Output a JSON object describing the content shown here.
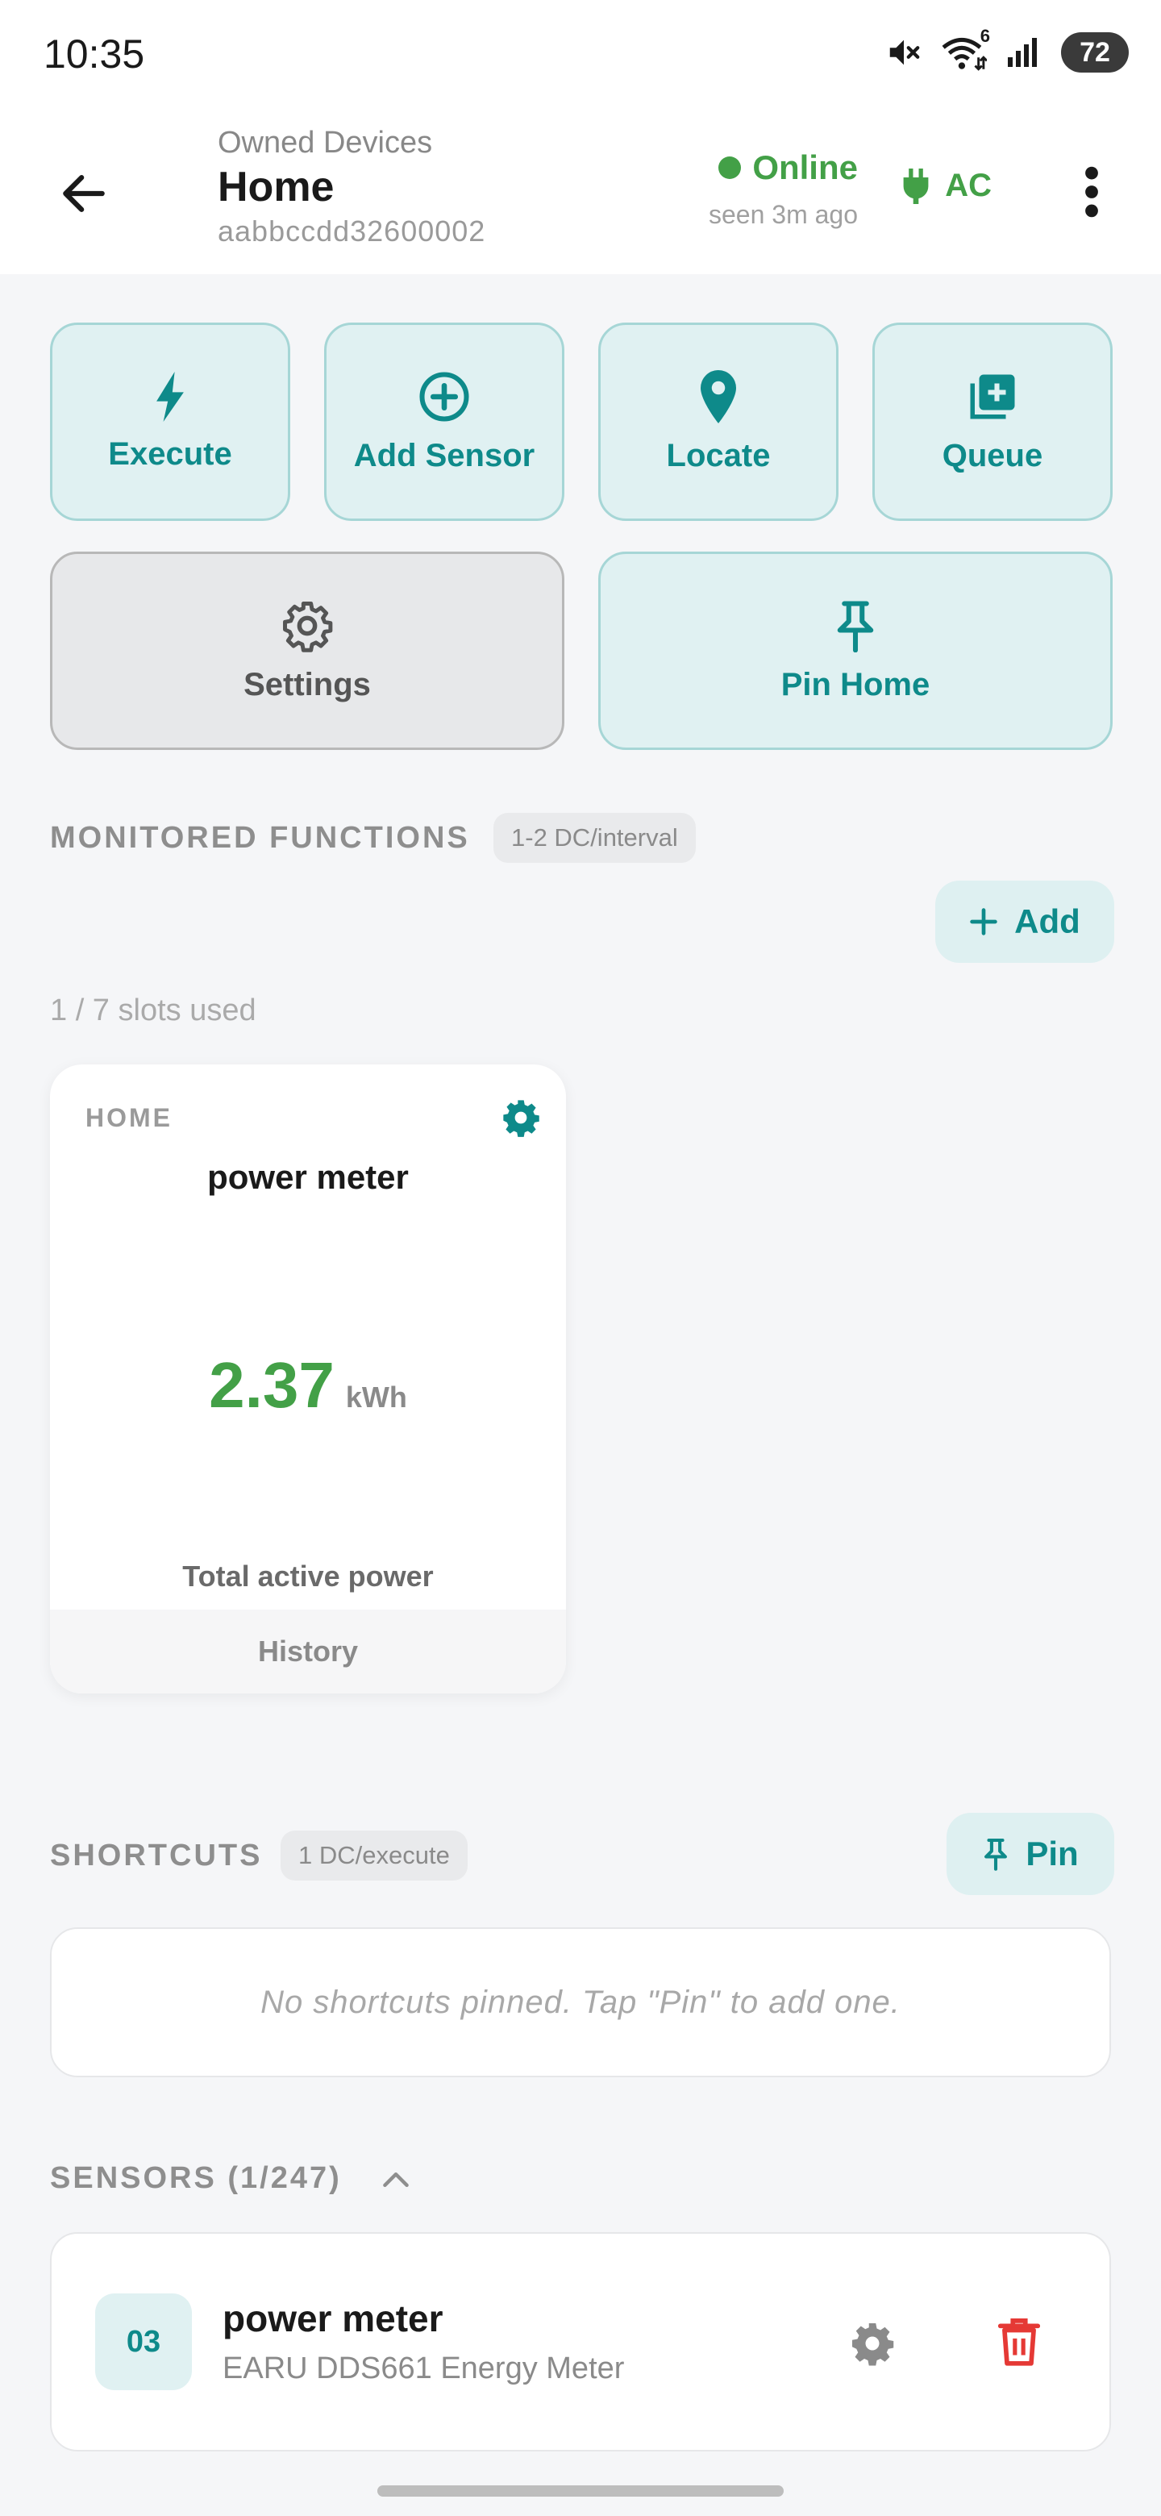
{
  "status_bar": {
    "time": "10:35",
    "battery": "72",
    "wifi_badge": "6"
  },
  "header": {
    "subtitle": "Owned Devices",
    "title": "Home",
    "device_id": "aabbccdd32600002",
    "status": "Online",
    "last_seen": "seen 3m ago",
    "power_source": "AC"
  },
  "actions": {
    "execute": "Execute",
    "add_sensor": "Add Sensor",
    "locate": "Locate",
    "queue": "Queue",
    "settings": "Settings",
    "pin_home": "Pin Home"
  },
  "monitored": {
    "title": "MONITORED FUNCTIONS",
    "chip": "1-2 DC/interval",
    "add_label": "Add",
    "slots": "1 / 7 slots used",
    "card": {
      "location": "HOME",
      "name": "power meter",
      "value": "2.37",
      "unit": "kWh",
      "description": "Total active power",
      "history": "History"
    }
  },
  "shortcuts": {
    "title": "SHORTCUTS",
    "chip": "1 DC/execute",
    "pin_label": "Pin",
    "empty": "No shortcuts pinned. Tap \"Pin\" to add one."
  },
  "sensors": {
    "title": "SENSORS (1/247)",
    "items": [
      {
        "number": "03",
        "name": "power meter",
        "model": "EARU DDS661 Energy Meter"
      }
    ]
  },
  "colors": {
    "accent": "#0e8a8a",
    "online": "#43a047",
    "delete": "#e53935"
  },
  "icons": {
    "back": "arrow-left-icon",
    "more": "more-vert-icon",
    "ac": "plug-icon",
    "execute": "bolt-icon",
    "add_sensor": "add-circle-icon",
    "locate": "location-pin-icon",
    "queue": "library-add-icon",
    "settings": "gear-icon",
    "pin": "pushpin-icon",
    "delete": "trash-icon",
    "collapse": "chevron-up-icon"
  }
}
